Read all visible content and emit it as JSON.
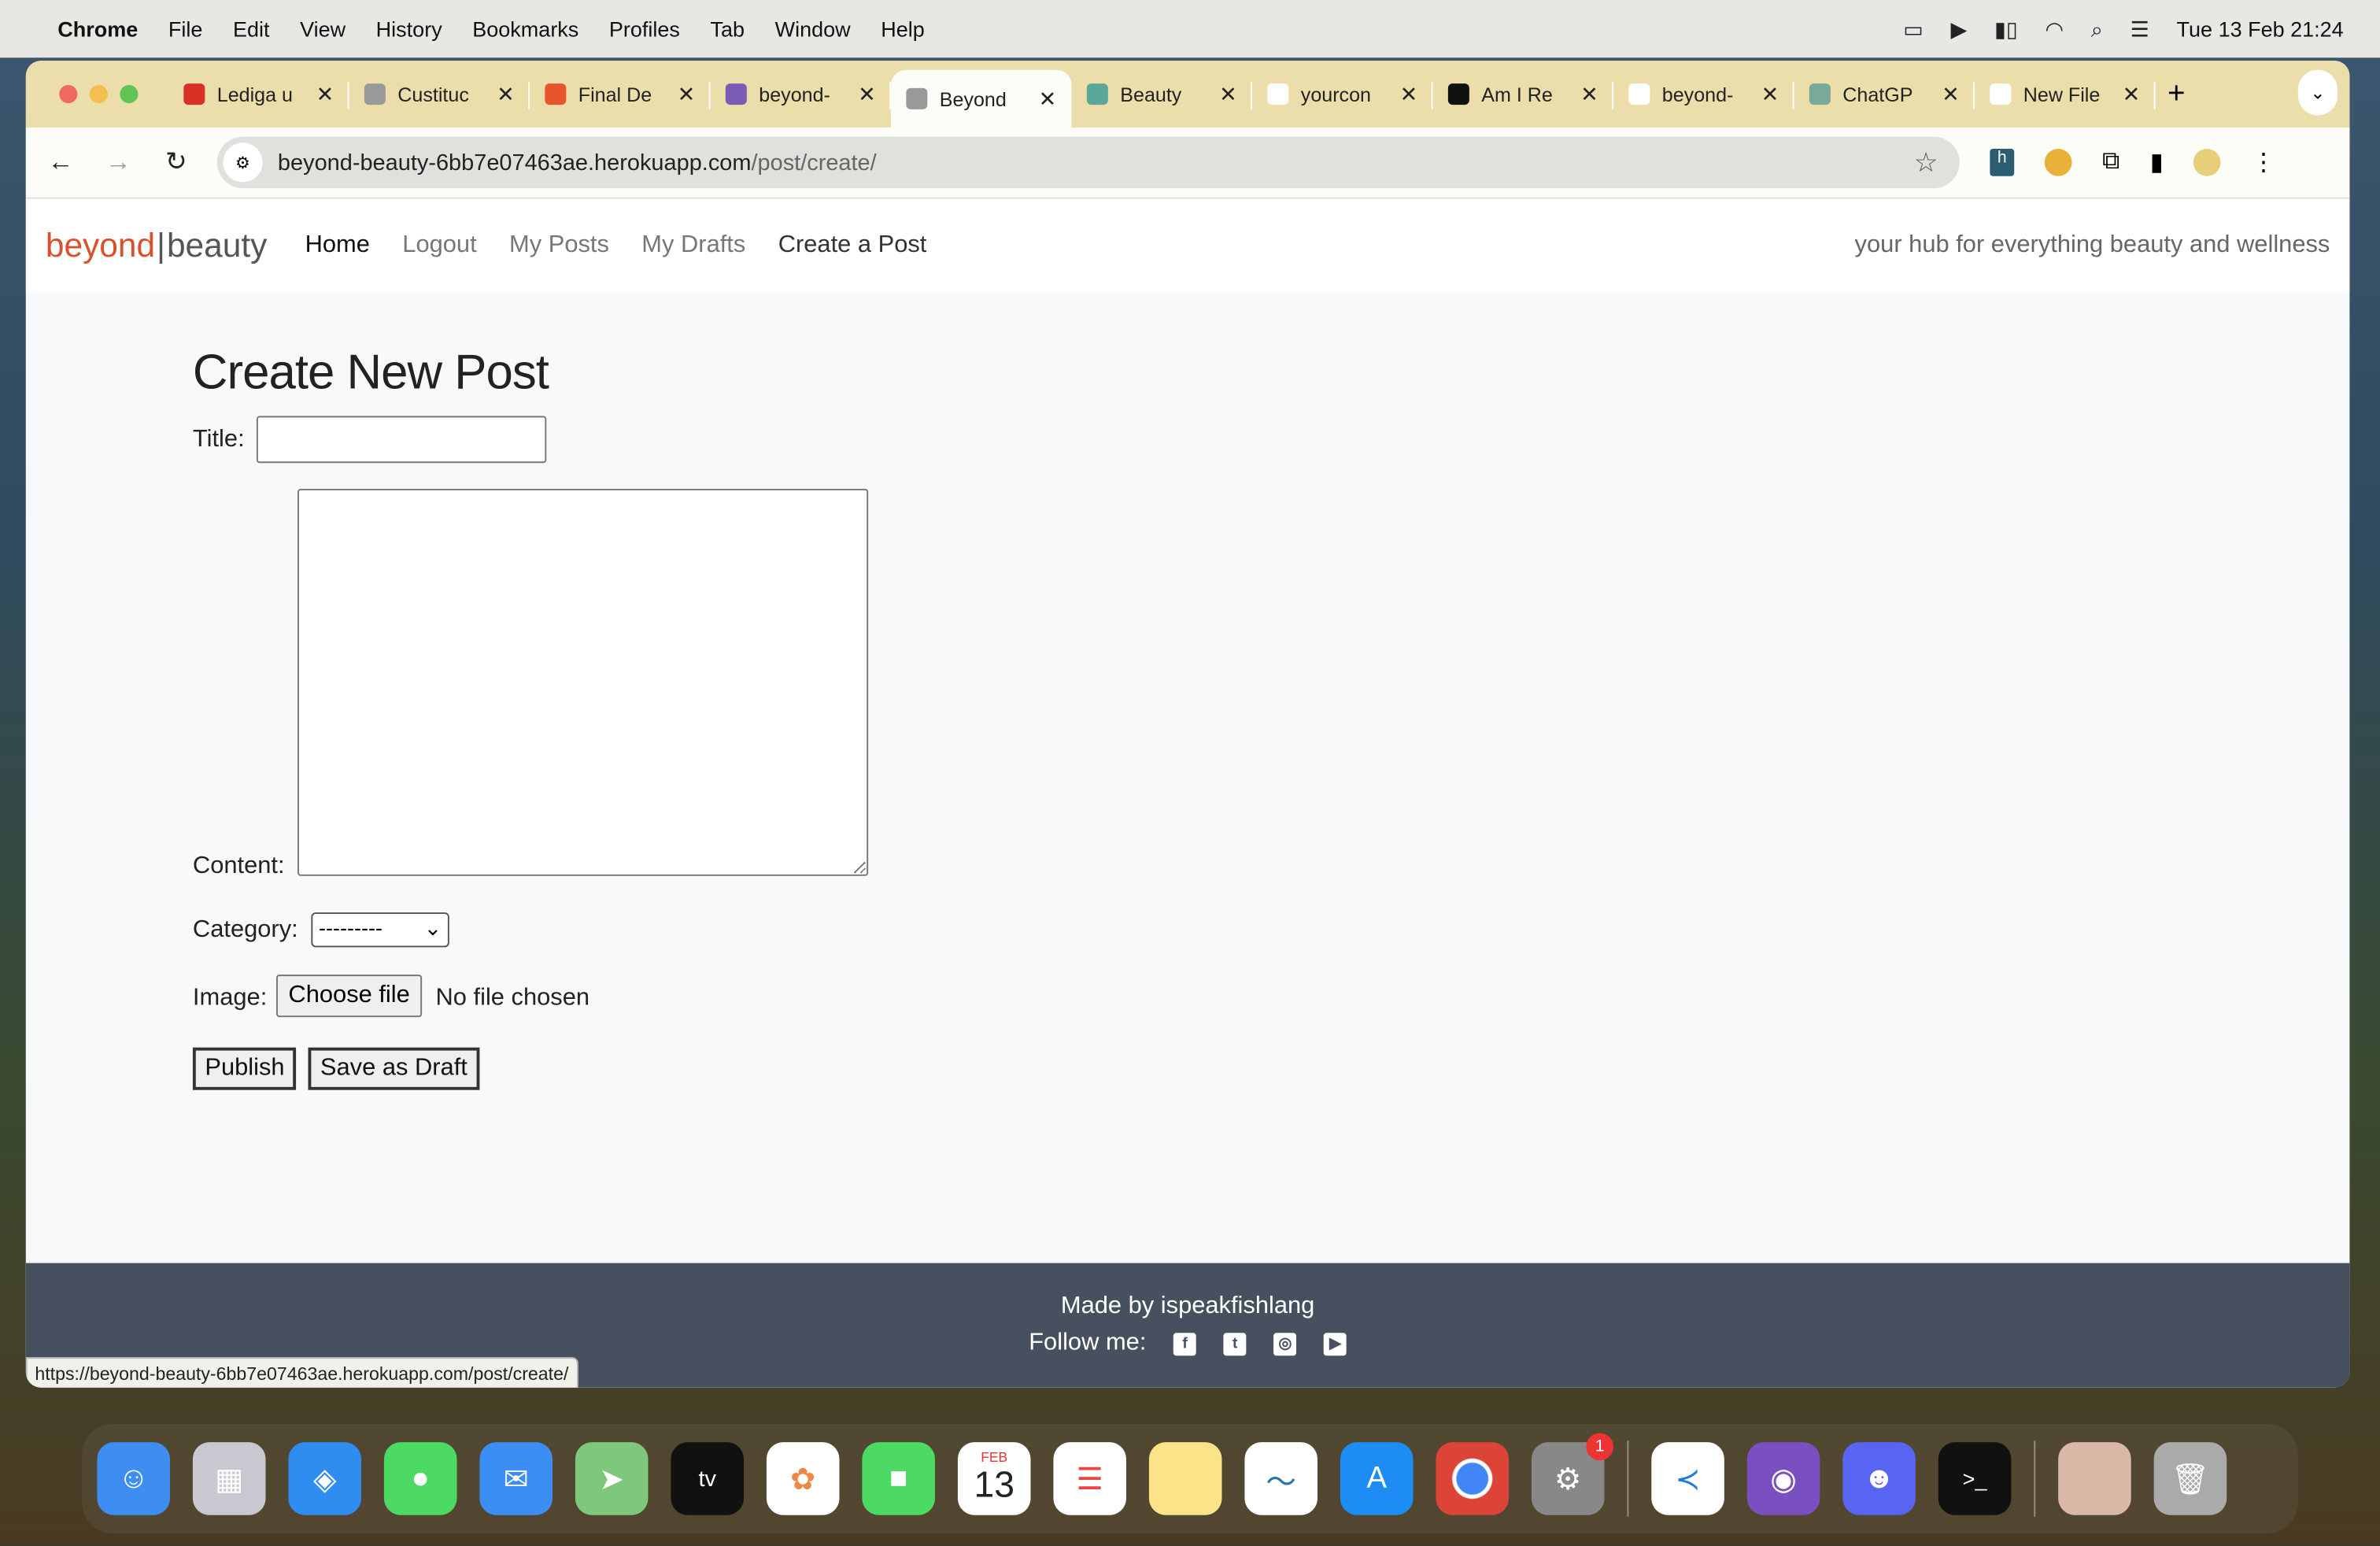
{
  "menubar": {
    "app": "Chrome",
    "items": [
      "File",
      "Edit",
      "View",
      "History",
      "Bookmarks",
      "Profiles",
      "Tab",
      "Window",
      "Help"
    ],
    "datetime": "Tue 13 Feb  21:24"
  },
  "tabs": [
    {
      "label": "Lediga u",
      "color": "#d93025"
    },
    {
      "label": "Custituc",
      "color": "#999999"
    },
    {
      "label": "Final De",
      "color": "#e8552c"
    },
    {
      "label": "beyond-",
      "color": "#7a5cb5"
    },
    {
      "label": "Beyond",
      "color": "#999999",
      "active": true
    },
    {
      "label": "Beauty",
      "color": "#5aa89a"
    },
    {
      "label": "yourcon",
      "color": "#ffffff"
    },
    {
      "label": "Am I Re",
      "color": "#111111"
    },
    {
      "label": "beyond-",
      "color": "#ffffff"
    },
    {
      "label": "ChatGP",
      "color": "#7aa89a"
    },
    {
      "label": "New File",
      "color": "#ffffff"
    }
  ],
  "address": {
    "host": "beyond-beauty-6bb7e07463ae.herokuapp.com",
    "path": "/post/create/"
  },
  "site": {
    "brand_a": "beyond",
    "brand_sep": "|",
    "brand_b": "beauty",
    "nav": [
      "Home",
      "Logout",
      "My Posts",
      "My Drafts",
      "Create a Post"
    ],
    "tagline": "your hub for everything beauty and wellness",
    "accent": "#d9512c"
  },
  "form": {
    "heading": "Create New Post",
    "title_label": "Title:",
    "title_value": "",
    "content_label": "Content:",
    "content_value": "",
    "category_label": "Category:",
    "category_selected": "---------",
    "image_label": "Image:",
    "choose_file": "Choose file",
    "no_file": "No file chosen",
    "publish": "Publish",
    "draft": "Save as Draft"
  },
  "footer": {
    "made_by": "Made by ispeakfishlang",
    "follow": "Follow me:",
    "social": [
      "facebook",
      "twitter",
      "instagram",
      "youtube"
    ]
  },
  "status_url": "https://beyond-beauty-6bb7e07463ae.herokuapp.com/post/create/",
  "dock": {
    "calendar_month": "FEB",
    "calendar_day": "13",
    "settings_badge": "1"
  }
}
